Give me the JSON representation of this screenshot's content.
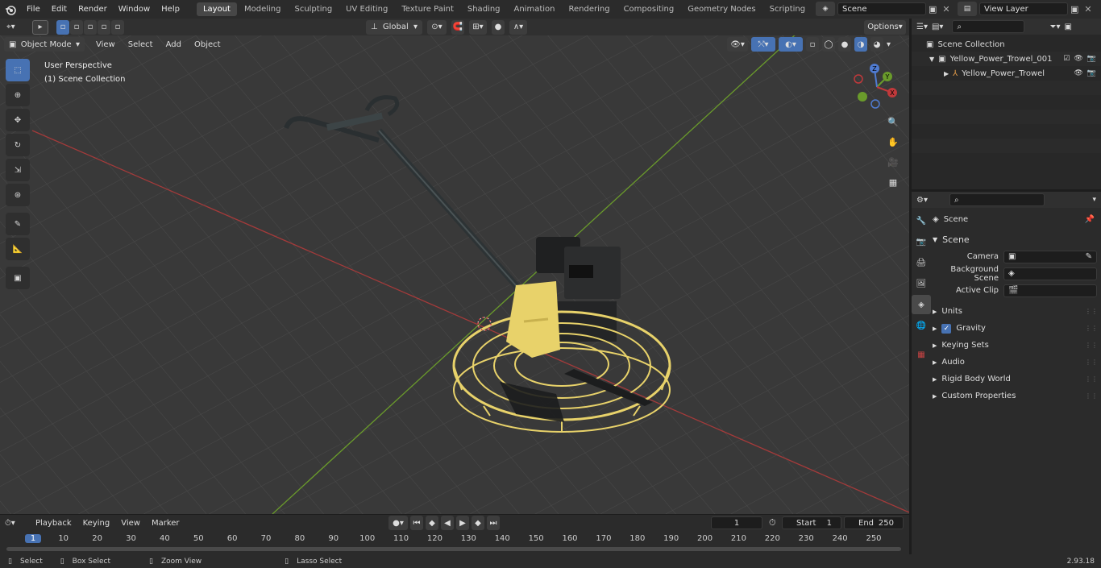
{
  "menu": {
    "file": "File",
    "edit": "Edit",
    "render": "Render",
    "window": "Window",
    "help": "Help"
  },
  "workspaces": [
    "Layout",
    "Modeling",
    "Sculpting",
    "UV Editing",
    "Texture Paint",
    "Shading",
    "Animation",
    "Rendering",
    "Compositing",
    "Geometry Nodes",
    "Scripting"
  ],
  "active_workspace": "Layout",
  "scene_field": "Scene",
  "view_layer_field": "View Layer",
  "viewport": {
    "mode": "Object Mode",
    "menus": [
      "View",
      "Select",
      "Add",
      "Object"
    ],
    "transform_orientation": "Global",
    "options": "Options",
    "overlay_title": "User Perspective",
    "overlay_subtitle": "(1) Scene Collection",
    "gizmo_axes": {
      "x": "X",
      "y": "Y",
      "z": "Z"
    }
  },
  "outliner": {
    "root": "Scene Collection",
    "items": [
      {
        "label": "Yellow_Power_Trowel_001"
      },
      {
        "label": "Yellow_Power_Trowel"
      }
    ]
  },
  "properties": {
    "breadcrumb": "Scene",
    "section": "Scene",
    "camera_label": "Camera",
    "background_scene_label": "Background Scene",
    "active_clip_label": "Active Clip",
    "panels": [
      "Units",
      "Gravity",
      "Keying Sets",
      "Audio",
      "Rigid Body World",
      "Custom Properties"
    ]
  },
  "timeline": {
    "menus": [
      "Playback",
      "Keying",
      "View",
      "Marker"
    ],
    "current_frame": "1",
    "start_label": "Start",
    "start_value": "1",
    "end_label": "End",
    "end_value": "250",
    "ticks": [
      "1",
      "10",
      "20",
      "30",
      "40",
      "50",
      "60",
      "70",
      "80",
      "90",
      "100",
      "110",
      "120",
      "130",
      "140",
      "150",
      "160",
      "170",
      "180",
      "190",
      "200",
      "210",
      "220",
      "230",
      "240",
      "250"
    ]
  },
  "statusbar": {
    "select": "Select",
    "box_select": "Box Select",
    "zoom_view": "Zoom View",
    "lasso_select": "Lasso Select",
    "version": "2.93.18"
  },
  "colors": {
    "accent": "#4772b3",
    "object_yellow": "#e8d26a",
    "x_axis": "#a33a3a",
    "y_axis": "#6a9b2b"
  }
}
